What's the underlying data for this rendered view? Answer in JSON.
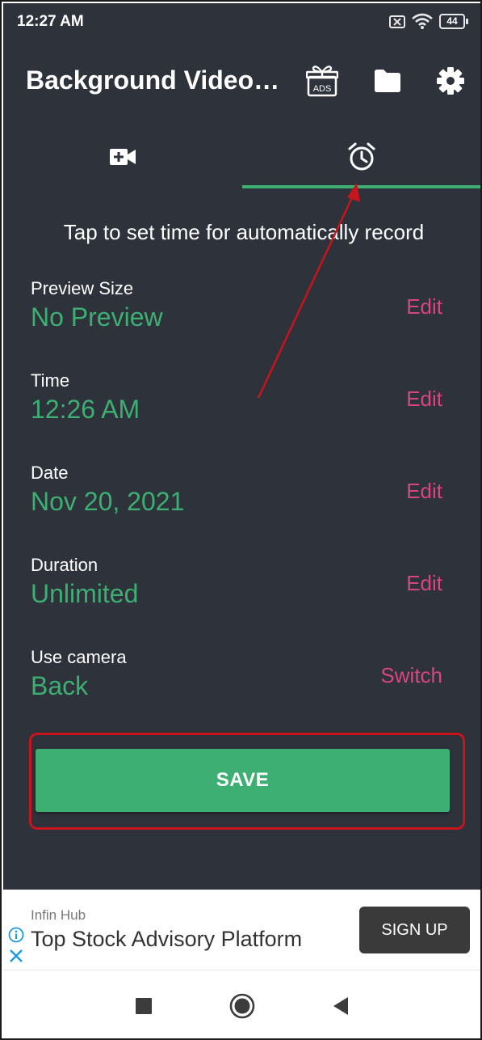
{
  "status_bar": {
    "time": "12:27 AM",
    "battery": "44",
    "icons": [
      "sim-off-icon",
      "wifi-icon",
      "battery-icon"
    ]
  },
  "app_bar": {
    "title": "Background Video…",
    "actions": [
      {
        "name": "remove-ads-icon",
        "label": "ADS"
      },
      {
        "name": "folder-icon"
      },
      {
        "name": "settings-gear-icon"
      }
    ]
  },
  "tabs": [
    {
      "name": "video-camera-icon",
      "selected": false
    },
    {
      "name": "alarm-clock-icon",
      "selected": true
    }
  ],
  "main": {
    "hint": "Tap to set time for automatically record",
    "settings": [
      {
        "label": "Preview Size",
        "value": "No Preview",
        "action": "Edit"
      },
      {
        "label": "Time",
        "value": "12:26 AM",
        "action": "Edit"
      },
      {
        "label": "Date",
        "value": "Nov 20, 2021",
        "action": "Edit"
      },
      {
        "label": "Duration",
        "value": "Unlimited",
        "action": "Edit"
      },
      {
        "label": "Use camera",
        "value": "Back",
        "action": "Switch"
      }
    ],
    "save_label": "SAVE"
  },
  "ad_banner": {
    "advertiser": "Infin Hub",
    "headline": "Top Stock Advisory Platform",
    "cta": "SIGN UP"
  },
  "nav_bar": {
    "buttons": [
      "recent-apps-icon",
      "home-icon",
      "back-icon"
    ]
  },
  "colors": {
    "background": "#2e323b",
    "accent_green": "#3daf72",
    "action_pink": "#d9467e",
    "annotation_red": "#c8141c"
  }
}
